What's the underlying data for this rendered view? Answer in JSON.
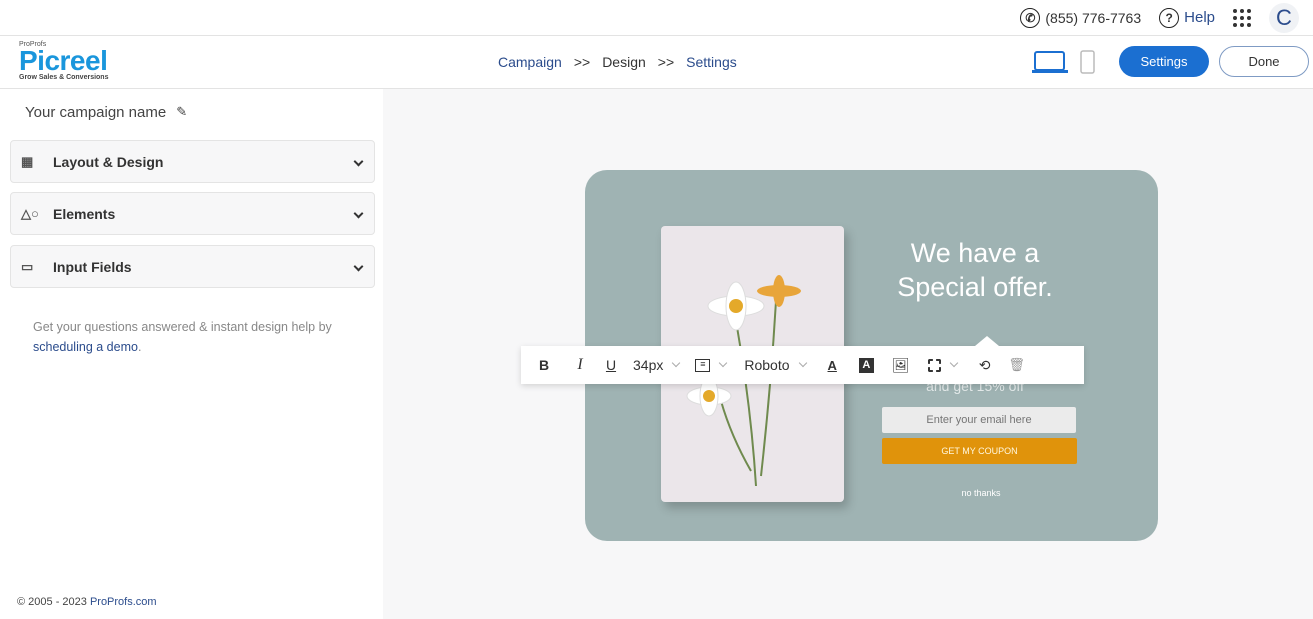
{
  "topbar": {
    "phone": "(855) 776-7763",
    "help": "Help",
    "avatar": "C"
  },
  "header": {
    "logo_small": "ProProfs",
    "logo": "Picreel",
    "logo_tagline": "Grow Sales & Conversions",
    "breadcrumb": [
      "Campaign",
      ">>",
      "Design",
      ">>",
      "Settings"
    ],
    "settings_label": "Settings",
    "done_label": "Done"
  },
  "sidebar": {
    "campaign_name": "Your campaign name",
    "sections": [
      {
        "label": "Layout & Design",
        "icon": "layout-icon"
      },
      {
        "label": "Elements",
        "icon": "shapes-icon"
      },
      {
        "label": "Input Fields",
        "icon": "input-field-icon"
      }
    ],
    "help_text": "Get your questions answered & instant design help by ",
    "help_link": "scheduling a demo",
    "help_end": ".",
    "copyright": "© 2005 - 2023 ",
    "copyright_link": "ProProfs.com"
  },
  "popup": {
    "title": "We have a Special offer.",
    "subtitle": "and get 15% off",
    "email_placeholder": "Enter your email here",
    "cta": "GET MY COUPON",
    "dismiss": "no thanks",
    "bg_color": "#9fb3b3",
    "cta_color": "#e0930b"
  },
  "toolbar": {
    "bold": "B",
    "italic": "I",
    "underline": "U",
    "font_size": "34px",
    "font_family": "Roboto"
  },
  "colors": {
    "accent": "#1b6fd1",
    "link": "#2b4c8c"
  }
}
